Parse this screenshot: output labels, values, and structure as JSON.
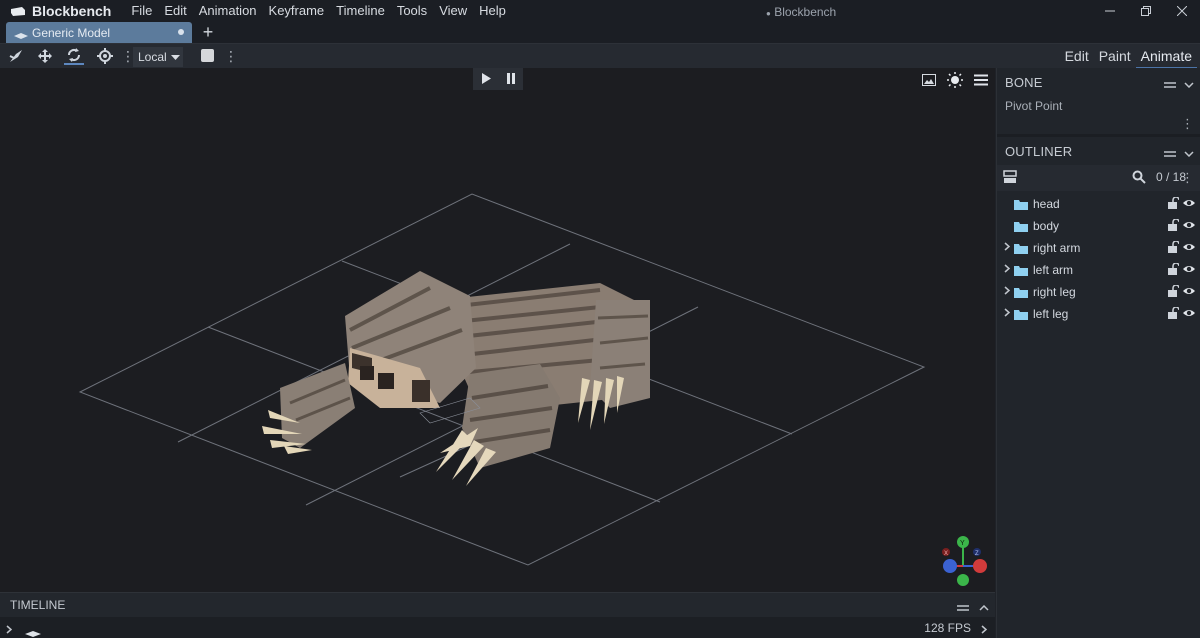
{
  "app": {
    "name": "Blockbench",
    "window_title": "Blockbench",
    "unsaved_marker": "●"
  },
  "menu": [
    "File",
    "Edit",
    "Animation",
    "Keyframe",
    "Timeline",
    "Tools",
    "View",
    "Help"
  ],
  "tabs": [
    {
      "label": "Generic Model",
      "unsaved": true
    }
  ],
  "toolbar": {
    "space_select": "Local",
    "modes": [
      "Edit",
      "Paint",
      "Animate"
    ],
    "selected_mode": "Animate"
  },
  "bone_panel": {
    "title": "BONE",
    "pivot_label": "Pivot Point"
  },
  "outliner": {
    "title": "OUTLINER",
    "count": "0 / 18",
    "items": [
      {
        "name": "head",
        "expandable": false
      },
      {
        "name": "body",
        "expandable": false
      },
      {
        "name": "right arm",
        "expandable": true
      },
      {
        "name": "left arm",
        "expandable": true
      },
      {
        "name": "right leg",
        "expandable": true
      },
      {
        "name": "left leg",
        "expandable": true
      }
    ]
  },
  "timeline": {
    "title": "TIMELINE",
    "fps": "128 FPS"
  },
  "gizmo": {
    "x_label": "X",
    "y_label": "Y",
    "z_label": "Z"
  },
  "colors": {
    "accent": "#4c74a8",
    "tab_active": "#5c7b9c",
    "folder": "#8fd0f0",
    "axis_x": "#d23b3b",
    "axis_y": "#3bb54a",
    "axis_z": "#3b62d2"
  },
  "icons": {
    "move": "move-arrows-icon",
    "rotate": "rotate-icon",
    "pivot": "pivot-target-icon",
    "play": "play-icon",
    "pause": "pause-icon",
    "image": "image-icon",
    "sun": "sun-icon",
    "menu": "hamburger-icon",
    "search": "search-icon",
    "lock": "unlock-icon",
    "eye": "eye-icon"
  }
}
